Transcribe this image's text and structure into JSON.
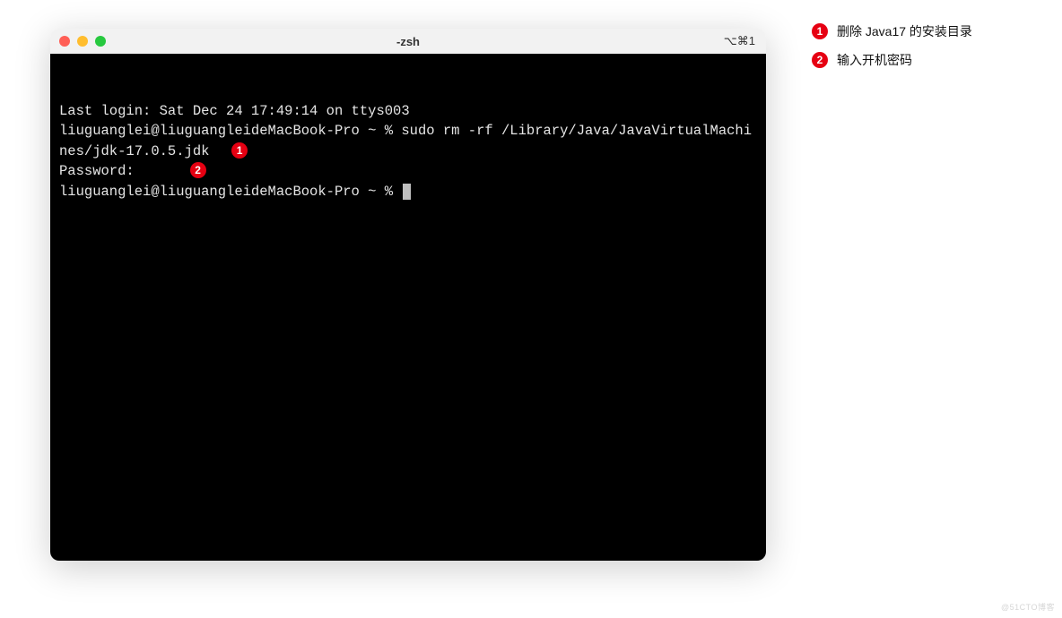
{
  "window": {
    "title": "-zsh",
    "shortcut": "⌥⌘1"
  },
  "terminal": {
    "line1": "Last login: Sat Dec 24 17:49:14 on ttys003",
    "line2_prompt": "liuguanglei@liuguangleideMacBook-Pro ~ % ",
    "line2_cmd": "sudo rm -rf /Library/Java/JavaVirtualMachines/jdk-17.0.5.jdk",
    "line3": "Password:",
    "line4_prompt": "liuguanglei@liuguangleideMacBook-Pro ~ % "
  },
  "callouts": {
    "badge1": "1",
    "badge2": "2",
    "legend1": "删除 Java17 的安装目录",
    "legend2": "输入开机密码"
  },
  "watermark": "@51CTO博客"
}
